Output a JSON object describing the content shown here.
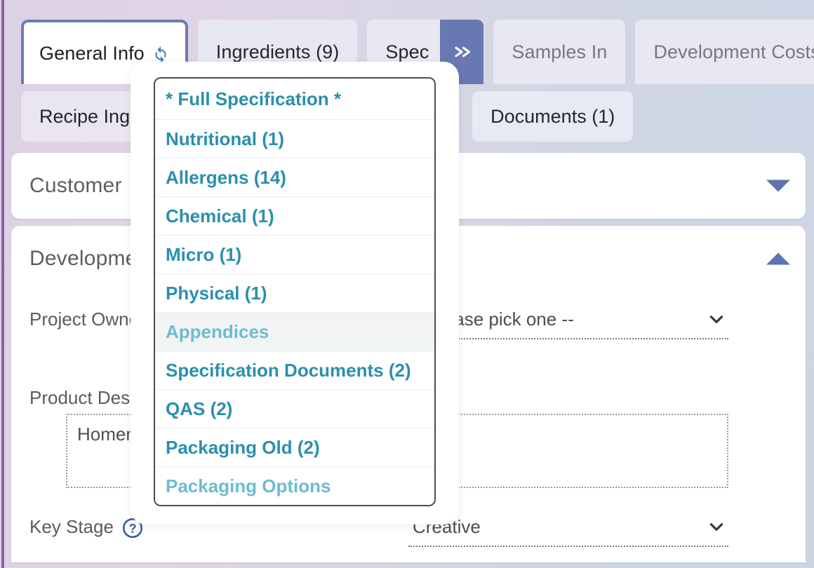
{
  "colors": {
    "accent_purple": "#8e5fa8",
    "tab_active_border": "#6c7cb3",
    "chip_blue": "#6878b2",
    "menu_teal": "#2b8fad",
    "menu_teal_light": "#6dbbd2",
    "panel_toggle": "#5f73b0"
  },
  "tabs_row1": [
    {
      "label": "General Info",
      "icon": "sync-icon",
      "state": "active"
    },
    {
      "label": "Ingredients (9)",
      "state": "inactive"
    },
    {
      "label": "Spec",
      "state": "inactive",
      "chip_icon": "double-chevron-right-icon"
    },
    {
      "label": "Samples In",
      "state": "inactive"
    },
    {
      "label": "Development Costs",
      "state": "inactive"
    }
  ],
  "tabs_row2": [
    {
      "label": "Recipe Ingredients"
    },
    {
      "label": "Documents (1)"
    }
  ],
  "panels": [
    {
      "title": "Customer",
      "toggle_icon": "triangle-down-icon",
      "expanded": false
    },
    {
      "title": "Development",
      "toggle_icon": "triangle-up-icon",
      "expanded": true
    }
  ],
  "form": {
    "project_owner": {
      "label": "Project Owner",
      "value": "-- please pick one --",
      "caret_icon": "chevron-down-icon"
    },
    "product_description": {
      "label": "Product Description",
      "value": "Homemade"
    },
    "key_stage": {
      "label": "Key Stage",
      "help_icon": "question-circle-icon",
      "value": "Creative",
      "caret_icon": "chevron-down-icon"
    }
  },
  "spec_dropdown": {
    "items": [
      {
        "label": "* Full Specification *",
        "faded": false
      },
      {
        "label": "Nutritional (1)",
        "faded": false
      },
      {
        "label": "Allergens (14)",
        "faded": false
      },
      {
        "label": "Chemical (1)",
        "faded": false
      },
      {
        "label": "Micro (1)",
        "faded": false
      },
      {
        "label": "Physical (1)",
        "faded": false
      },
      {
        "label": "Appendices",
        "faded": true,
        "hovered": true
      },
      {
        "label": "Specification Documents (2)",
        "faded": false
      },
      {
        "label": "QAS (2)",
        "faded": false
      },
      {
        "label": "Packaging Old (2)",
        "faded": false
      },
      {
        "label": "Packaging Options",
        "faded": true
      }
    ]
  }
}
